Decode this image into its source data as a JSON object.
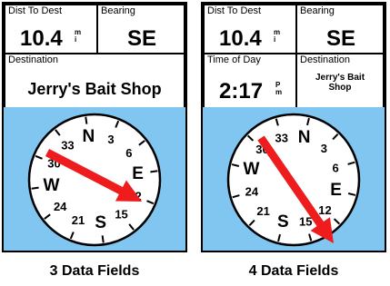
{
  "screens": [
    {
      "caption": "3 Data Fields",
      "dist_label": "Dist To Dest",
      "dist_value": "10.4",
      "dist_unit": [
        "m",
        "i"
      ],
      "bearing_label": "Bearing",
      "bearing_value": "SE",
      "destination_label": "Destination",
      "destination_value": "Jerry's Bait Shop",
      "compass_labels": [
        "N",
        "3",
        "6",
        "E",
        "12",
        "15",
        "S",
        "21",
        "24",
        "W",
        "30",
        "33"
      ]
    },
    {
      "caption": "4 Data Fields",
      "dist_label": "Dist To Dest",
      "dist_value": "10.4",
      "dist_unit": [
        "m",
        "i"
      ],
      "bearing_label": "Bearing",
      "bearing_value": "SE",
      "time_label": "Time of Day",
      "time_value": "2:17",
      "time_unit": [
        "P",
        "m"
      ],
      "destination_label": "Destination",
      "destination_value_line1": "Jerry's Bait",
      "destination_value_line2": "Shop",
      "compass_labels": [
        "N",
        "3",
        "6",
        "E",
        "12",
        "15",
        "S",
        "21",
        "24",
        "W",
        "30",
        "33"
      ]
    }
  ],
  "colors": {
    "compass_bg": "#80c6f0",
    "pointer": "#ee1c1c",
    "dial": "#ffffff"
  }
}
